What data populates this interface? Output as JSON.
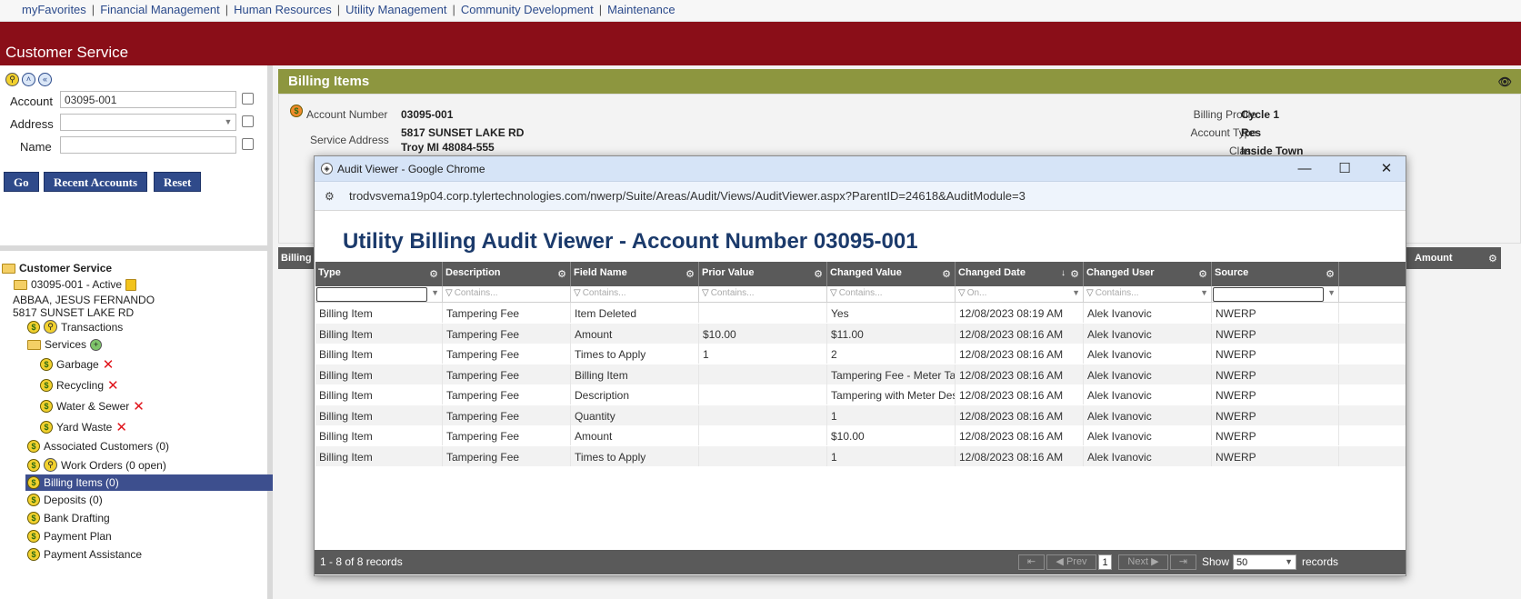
{
  "nav": {
    "links": [
      "myFavorites",
      "Financial Management",
      "Human Resources",
      "Utility Management",
      "Community Development",
      "Maintenance"
    ],
    "separator": "|"
  },
  "header": {
    "title": "Customer Service"
  },
  "search": {
    "account_label": "Account",
    "account_value": "03095-001",
    "address_label": "Address",
    "address_value": "",
    "name_label": "Name",
    "name_value": "",
    "go_label": "Go",
    "recent_label": "Recent Accounts",
    "reset_label": "Reset"
  },
  "tree": {
    "root": "Customer Service",
    "account": "03095-001 - Active",
    "customer_name": "ABBAA, JESUS FERNANDO",
    "address": "5817 SUNSET LAKE RD",
    "transactions": "Transactions",
    "services": "Services",
    "service_items": [
      "Garbage",
      "Recycling",
      "Water & Sewer",
      "Yard Waste"
    ],
    "associated_customers": "Associated Customers (0)",
    "work_orders": "Work Orders (0 open)",
    "billing_items": "Billing Items (0)",
    "deposits": "Deposits (0)",
    "bank_drafting": "Bank Drafting",
    "payment_plan": "Payment Plan",
    "payment_assistance": "Payment Assistance"
  },
  "billing": {
    "title": "Billing Items",
    "account_number_label": "Account Number",
    "account_number": "03095-001",
    "service_address_label": "Service Address",
    "service_address_line1": "5817 SUNSET LAKE RD",
    "service_address_line2": "Troy MI 48084-555",
    "billing_profile_label": "Billing Profile",
    "billing_profile": "Cycle 1",
    "account_type_label": "Account Type",
    "account_type": "Res",
    "class_label": "Class",
    "class_value": "Inside Town",
    "grid_col_first": "Billing I",
    "grid_col_amount": "Amount"
  },
  "modal": {
    "window_title": "Audit Viewer - Google Chrome",
    "url": "trodvsvema19p04.corp.tylertechnologies.com/nwerp/Suite/Areas/Audit/Views/AuditViewer.aspx?ParentID=24618&AuditModule=3",
    "heading": "Utility Billing Audit Viewer - Account Number 03095-001",
    "columns": [
      "Type",
      "Description",
      "Field Name",
      "Prior Value",
      "Changed Value",
      "Changed Date",
      "Changed User",
      "Source"
    ],
    "filter_contains": "Contains...",
    "filter_on": "On...",
    "rows": [
      [
        "Billing Item",
        "Tampering Fee",
        "Item Deleted",
        "",
        "Yes",
        "12/08/2023 08:19 AM",
        "Alek Ivanovic",
        "NWERP"
      ],
      [
        "Billing Item",
        "Tampering Fee",
        "Amount",
        "$10.00",
        "$11.00",
        "12/08/2023 08:16 AM",
        "Alek Ivanovic",
        "NWERP"
      ],
      [
        "Billing Item",
        "Tampering Fee",
        "Times to Apply",
        "1",
        "2",
        "12/08/2023 08:16 AM",
        "Alek Ivanovic",
        "NWERP"
      ],
      [
        "Billing Item",
        "Tampering Fee",
        "Billing Item",
        "",
        "Tampering Fee - Meter Tam",
        "12/08/2023 08:16 AM",
        "Alek Ivanovic",
        "NWERP"
      ],
      [
        "Billing Item",
        "Tampering Fee",
        "Description",
        "",
        "Tampering with Meter Desc",
        "12/08/2023 08:16 AM",
        "Alek Ivanovic",
        "NWERP"
      ],
      [
        "Billing Item",
        "Tampering Fee",
        "Quantity",
        "",
        "1",
        "12/08/2023 08:16 AM",
        "Alek Ivanovic",
        "NWERP"
      ],
      [
        "Billing Item",
        "Tampering Fee",
        "Amount",
        "",
        "$10.00",
        "12/08/2023 08:16 AM",
        "Alek Ivanovic",
        "NWERP"
      ],
      [
        "Billing Item",
        "Tampering Fee",
        "Times to Apply",
        "",
        "1",
        "12/08/2023 08:16 AM",
        "Alek Ivanovic",
        "NWERP"
      ]
    ],
    "pager": {
      "summary": "1 - 8 of 8 records",
      "prev": "Prev",
      "next": "Next",
      "page": "1",
      "show_label": "Show",
      "page_size": "50",
      "records_label": "records"
    }
  }
}
